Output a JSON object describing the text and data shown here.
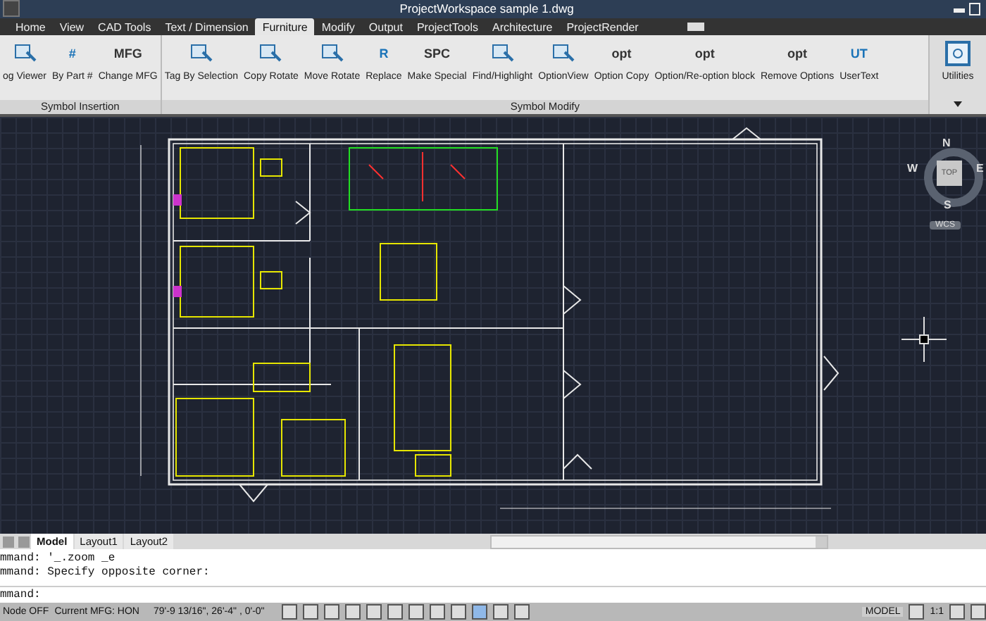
{
  "window": {
    "title": "ProjectWorkspace    sample 1.dwg"
  },
  "tabs": [
    {
      "label": "Home",
      "selected": false
    },
    {
      "label": "View",
      "selected": false
    },
    {
      "label": "CAD Tools",
      "selected": false
    },
    {
      "label": "Text / Dimension",
      "selected": false
    },
    {
      "label": "Furniture",
      "selected": true
    },
    {
      "label": "Modify",
      "selected": false
    },
    {
      "label": "Output",
      "selected": false
    },
    {
      "label": "ProjectTools",
      "selected": false
    },
    {
      "label": "Architecture",
      "selected": false
    },
    {
      "label": "ProjectRender",
      "selected": false
    }
  ],
  "ribbon_panels": [
    {
      "label": "Symbol Insertion",
      "buttons": [
        {
          "label": "og Viewer"
        },
        {
          "label": "By Part #",
          "icon_text": "#"
        },
        {
          "label": "Change MFG",
          "icon_text": "MFG"
        }
      ]
    },
    {
      "label": "Symbol Modify",
      "buttons": [
        {
          "label": "Tag By Selection"
        },
        {
          "label": "Copy Rotate"
        },
        {
          "label": "Move Rotate"
        },
        {
          "label": "Replace",
          "icon_text": "R"
        },
        {
          "label": "Make Special",
          "icon_text": "SPC"
        },
        {
          "label": "Find/Highlight"
        },
        {
          "label": "OptionView"
        },
        {
          "label": "Option Copy",
          "icon_text": "opt"
        },
        {
          "label": "Option/Re-option block",
          "icon_text": "opt"
        },
        {
          "label": "Remove Options",
          "icon_text": "opt"
        },
        {
          "label": "UserText",
          "icon_text": "UT"
        }
      ]
    }
  ],
  "utilities": {
    "label": "Utilities"
  },
  "viewcube": {
    "north": "N",
    "south": "S",
    "east": "E",
    "west": "W",
    "face": "TOP",
    "ucs": "WCS"
  },
  "layout_tabs": [
    {
      "label": "Model",
      "selected": true
    },
    {
      "label": "Layout1",
      "selected": false
    },
    {
      "label": "Layout2",
      "selected": false
    }
  ],
  "command_history": [
    "mmand: '_.zoom _e",
    "mmand: Specify opposite corner:"
  ],
  "command_prompt": "mmand:",
  "status_bar": {
    "node": "Node OFF",
    "mfg": "Current MFG: HON",
    "coordinates": "79'-9 13/16\", 26'-4\"   , 0'-0\"",
    "space": "MODEL",
    "scale": "1:1"
  }
}
